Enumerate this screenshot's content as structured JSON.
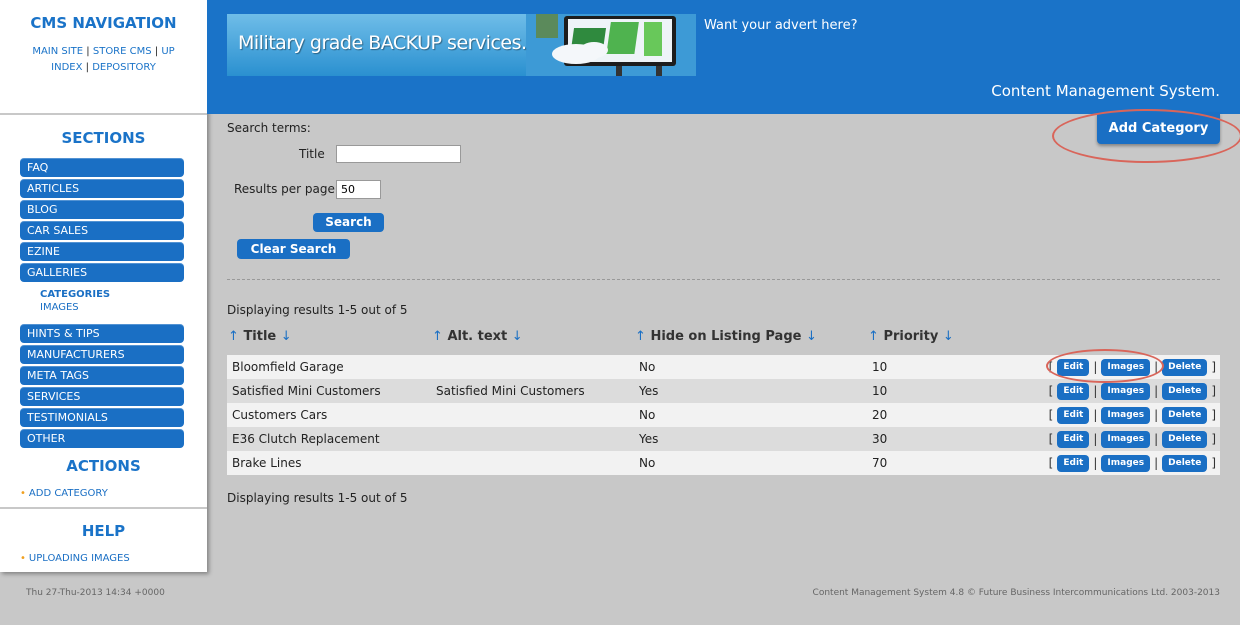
{
  "sidebar": {
    "nav_title": "CMS NAVIGATION",
    "top_links": [
      "MAIN SITE",
      "STORE CMS",
      "UP",
      "INDEX",
      "DEPOSITORY"
    ],
    "sections_title": "SECTIONS",
    "sections": [
      "FAQ",
      "ARTICLES",
      "BLOG",
      "CAR SALES",
      "EZINE",
      "GALLERIES",
      "HINTS & TIPS",
      "MANUFACTURERS",
      "META TAGS",
      "SERVICES",
      "TESTIMONIALS",
      "OTHER"
    ],
    "galleries_sub": [
      "CATEGORIES",
      "IMAGES"
    ],
    "actions_title": "ACTIONS",
    "actions": [
      "ADD CATEGORY"
    ],
    "help_title": "HELP",
    "help": [
      "UPLOADING IMAGES"
    ]
  },
  "header": {
    "banner_text": "Military grade BACKUP services.",
    "advert_text": "Want your advert here?",
    "cms_text": "Content Management System."
  },
  "search": {
    "terms_label": "Search terms:",
    "title_label": "Title",
    "title_value": "",
    "rpp_label": "Results per page",
    "rpp_value": "50",
    "search_button": "Search",
    "clear_button": "Clear Search"
  },
  "add_category_button": "Add Category",
  "results": {
    "displaying_top": "Displaying results 1-5 out of 5",
    "displaying_bottom": "Displaying results 1-5 out of 5",
    "columns": [
      "Title",
      "Alt. text",
      "Hide on Listing Page",
      "Priority"
    ],
    "rows": [
      {
        "title": "Bloomfield Garage",
        "alt": "",
        "hide": "No",
        "priority": "10"
      },
      {
        "title": "Satisfied Mini Customers",
        "alt": "Satisfied Mini Customers",
        "hide": "Yes",
        "priority": "10"
      },
      {
        "title": "Customers Cars",
        "alt": "",
        "hide": "No",
        "priority": "20"
      },
      {
        "title": "E36 Clutch Replacement",
        "alt": "",
        "hide": "Yes",
        "priority": "30"
      },
      {
        "title": "Brake Lines",
        "alt": "",
        "hide": "No",
        "priority": "70"
      }
    ],
    "row_actions": {
      "edit": "Edit",
      "images": "Images",
      "delete": "Delete"
    }
  },
  "footer": {
    "date": "Thu 27-Thu-2013 14:34 +0000",
    "copyright": "Content Management System 4.8 © Future Business Intercommunications Ltd. 2003-2013"
  },
  "colors": {
    "brand_blue": "#1a73c8",
    "button_blue": "#1a6fc4",
    "highlight_red": "#d9655a",
    "accent_orange": "#f0a020"
  }
}
